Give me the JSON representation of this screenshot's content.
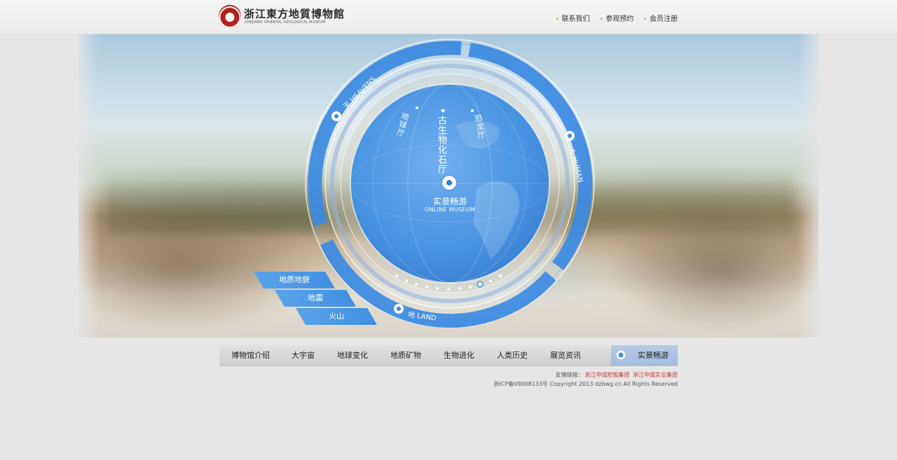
{
  "header": {
    "logo_cn": "浙江東方地質博物館",
    "logo_en": "ZHEJIANG ORIENTAL GEOLOGICAL MUSEUM",
    "links": [
      "联系我们",
      "参观预约",
      "会员注册"
    ]
  },
  "dial": {
    "center_cn": "实景畅游",
    "center_en": "ONLINE MUSEUM",
    "ring_heavens": "天 HEAVENS",
    "ring_human": "人 HUMAN",
    "ring_land": "地 LAND",
    "globe_items": [
      "古生物化石厅",
      "恐龙厅",
      "地球厅"
    ]
  },
  "side_menu": [
    "地质地貌",
    "地震",
    "火山"
  ],
  "nav": {
    "items": [
      "博物馆介绍",
      "大宇宙",
      "地球变化",
      "地质矿物",
      "生物进化",
      "人类历史",
      "展览资讯"
    ],
    "special": "实景畅游"
  },
  "footer": {
    "links_label": "友情链接：",
    "links": [
      "浙江中成控股集团",
      "浙江中成实业集团"
    ],
    "copyright": "浙ICP备09008133号 Copyright 2013 dzbwg.cn All Rights Reserved"
  },
  "colors": {
    "accent": "#3a8ae0",
    "nav_special": "#a9c0e3",
    "link_red": "#c0342b"
  }
}
